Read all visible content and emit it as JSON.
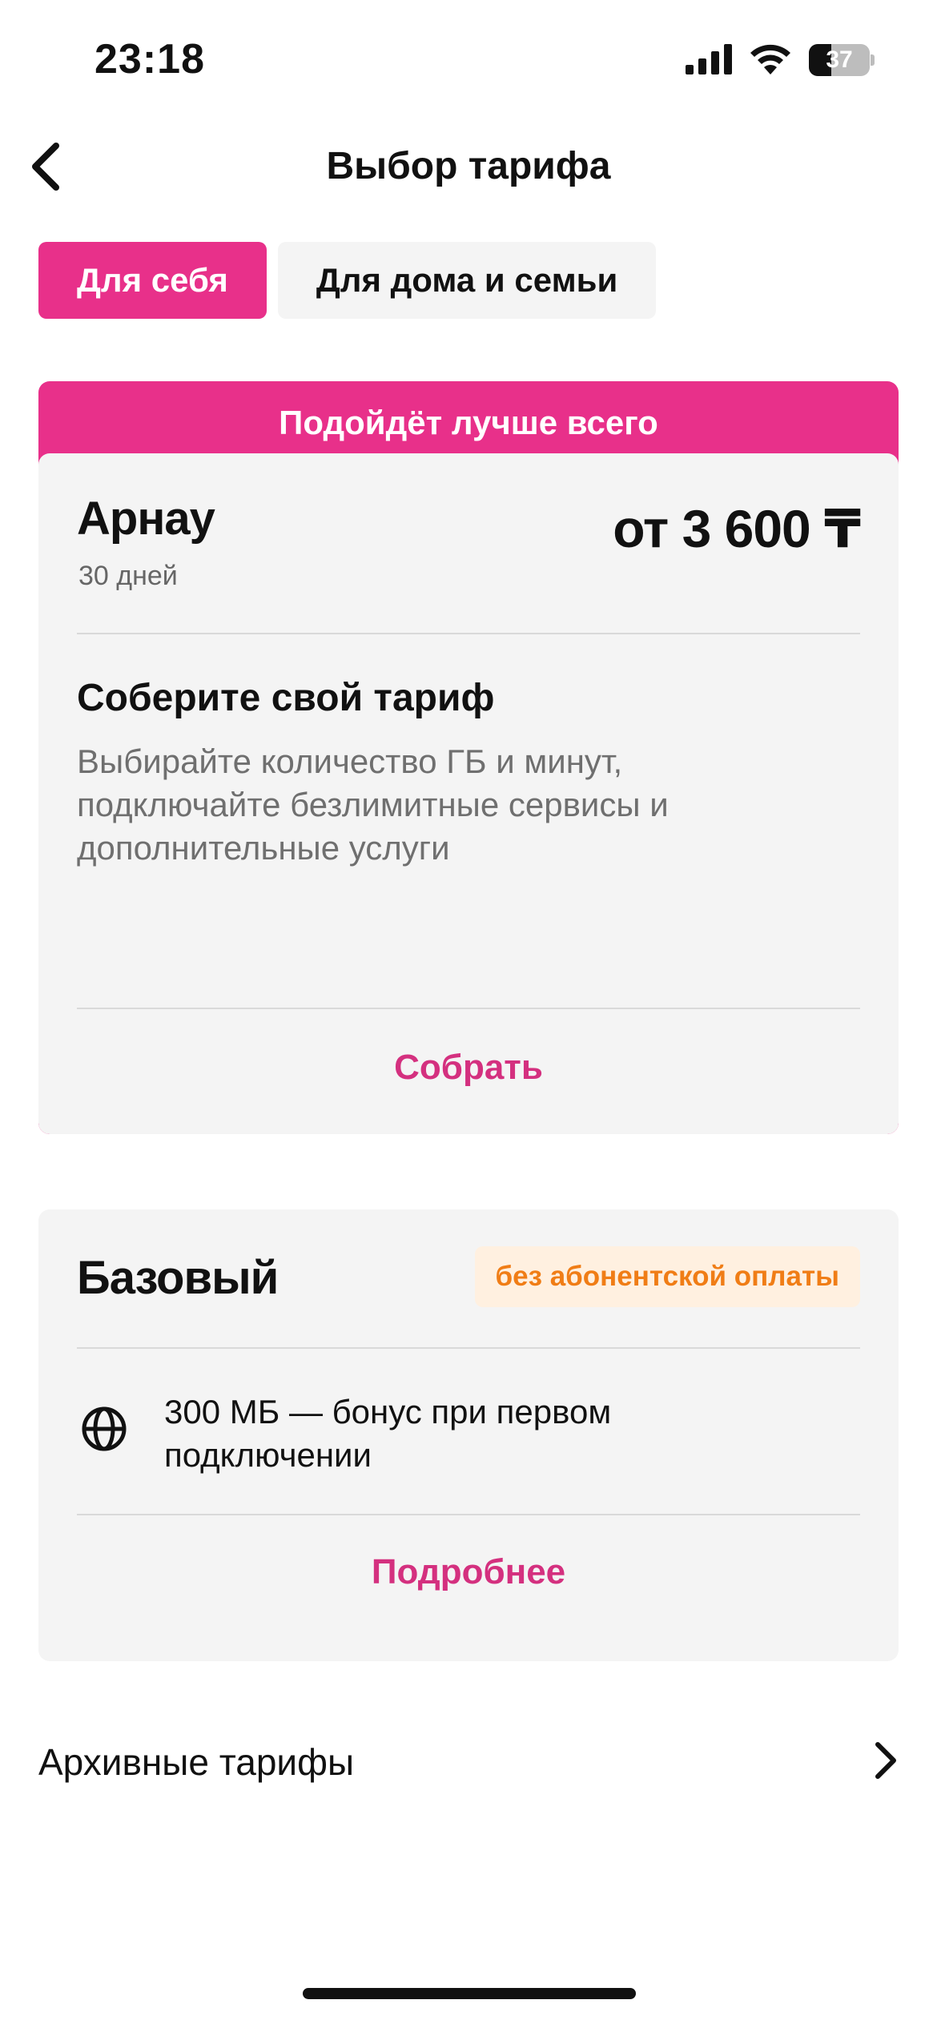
{
  "status_bar": {
    "time": "23:18",
    "battery_level": "37",
    "battery_fraction": 0.37,
    "icons": [
      "signal-icon",
      "wifi-icon",
      "battery-icon"
    ]
  },
  "nav": {
    "title": "Выбор тарифа",
    "back_icon": "chevron-left-icon"
  },
  "tabs": [
    {
      "label": "Для себя",
      "active": true
    },
    {
      "label": "Для дома и семьи",
      "active": false
    }
  ],
  "recommended_card": {
    "banner": "Подойдёт лучше всего",
    "name": "Арнау",
    "duration": "30 дней",
    "price": "от 3 600 ₸",
    "section_title": "Соберите свой тариф",
    "section_desc": "Выбирайте количество ГБ и минут, подключайте безлимитные сервисы и дополнительные услуги",
    "action": "Собрать"
  },
  "basic_card": {
    "name": "Базовый",
    "badge": "без абонентской оплаты",
    "feature_icon": "globe-icon",
    "feature": "300 МБ — бонус при первом подключении",
    "action": "Подробнее"
  },
  "archive": {
    "label": "Архивные тарифы",
    "icon": "chevron-right-icon"
  },
  "colors": {
    "accent": "#E8308A",
    "link": "#D4307F",
    "badge_bg": "#FFF0E0",
    "badge_text": "#F07D16",
    "card_bg": "#F4F4F4"
  }
}
